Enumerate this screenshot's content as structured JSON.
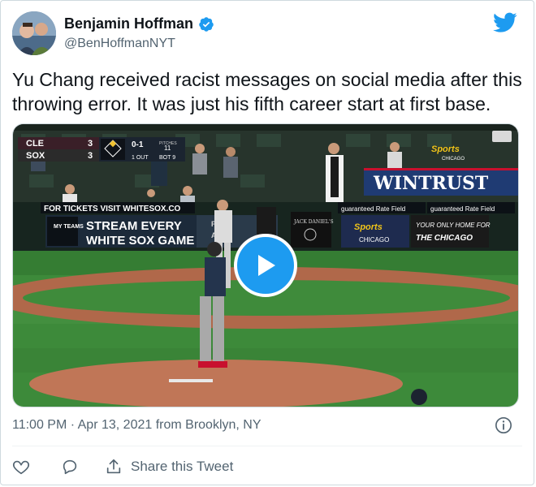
{
  "author": {
    "name": "Benjamin Hoffman",
    "handle": "@BenHoffmanNYT",
    "verified": true
  },
  "tweet": {
    "text": "Yu Chang received racist messages on social media after this throwing error. It was just his fifth career start at first base."
  },
  "media": {
    "scoreboard": {
      "team1": "CLE",
      "score1": "3",
      "team2": "SOX",
      "score2": "3",
      "count": "0-1",
      "pitches_label": "PITCHES",
      "pitches": "11",
      "outs": "1 OUT",
      "inning": "BOT 9"
    },
    "signs": {
      "tickets": "FOR TICKETS VISIT WHITESOX.CO",
      "stream_line1": "STREAM EVERY",
      "stream_line2": "WHITE SOX GAME",
      "my_teams": "MY TEAMS",
      "wintrust": "WINTRUST",
      "guaranteed_rate": "guaranteed Rate Field",
      "nbc_sports": "Sports",
      "chicago": "CHICAGO",
      "your_only": "YOUR ONLY HOME FOR",
      "the_chicago": "THE CHICAGO",
      "jack_daniels": "JACK DANIEL'S",
      "park": "PARK",
      "ale": "ALE"
    },
    "play_button_label": "Play video"
  },
  "meta": {
    "timestamp": "11:00 PM · Apr 13, 2021 from Brooklyn, NY"
  },
  "actions": {
    "share_label": "Share this Tweet"
  },
  "colors": {
    "twitter_blue": "#1d9bf0",
    "text": "#0f1419",
    "secondary": "#536471"
  }
}
